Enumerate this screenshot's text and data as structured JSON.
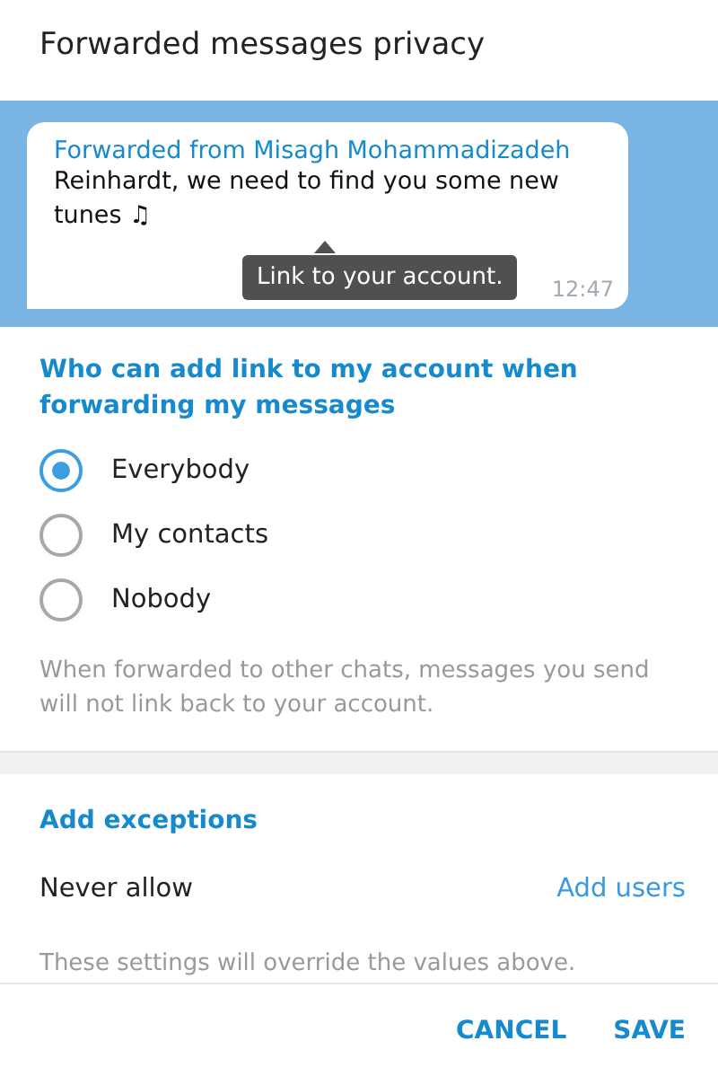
{
  "window": {
    "title": "Forwarded messages privacy"
  },
  "preview": {
    "forwarded_from": "Forwarded from Misagh Mohammadizadeh",
    "message": "Reinhardt, we need to find you some new tunes ♫",
    "time": "12:47",
    "tooltip": "Link to your account."
  },
  "section": {
    "title": "Who can add link to my account when forwarding my messages",
    "options": [
      {
        "label": "Everybody",
        "selected": true
      },
      {
        "label": "My contacts",
        "selected": false
      },
      {
        "label": "Nobody",
        "selected": false
      }
    ],
    "note": "When forwarded to other chats, messages you send will not link back to your account."
  },
  "exceptions": {
    "title": "Add exceptions",
    "row_label": "Never allow",
    "row_action": "Add users",
    "note": "These settings will override the values above."
  },
  "buttons": [
    "CANCEL",
    "SAVE"
  ]
}
